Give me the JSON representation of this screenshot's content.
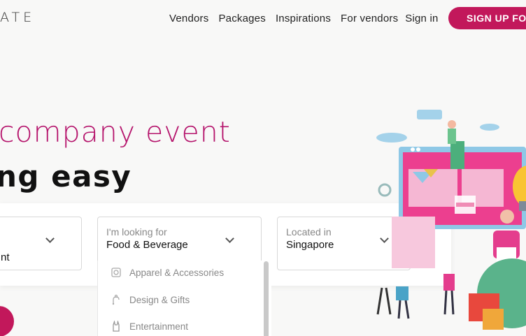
{
  "header": {
    "logo_text": "ATE",
    "nav": [
      "Vendors",
      "Packages",
      "Inspirations",
      "For vendors"
    ],
    "signin": "Sign in",
    "signup": "SIGN UP FO"
  },
  "hero": {
    "line1": "company event",
    "line2": "ng easy"
  },
  "search": {
    "field1": {
      "value": "nt"
    },
    "field2": {
      "label": "I'm looking for",
      "value": "Food & Beverage"
    },
    "field3": {
      "label": "Located in",
      "value": "Singapore"
    }
  },
  "dropdown": {
    "items": [
      {
        "label": "Apparel & Accessories",
        "icon": "shirt-icon"
      },
      {
        "label": "Design & Gifts",
        "icon": "gift-icon"
      },
      {
        "label": "Entertainment",
        "icon": "rock-hand-icon"
      }
    ]
  },
  "colors": {
    "brand": "#c2185b",
    "headline_accent": "#b5146c"
  }
}
